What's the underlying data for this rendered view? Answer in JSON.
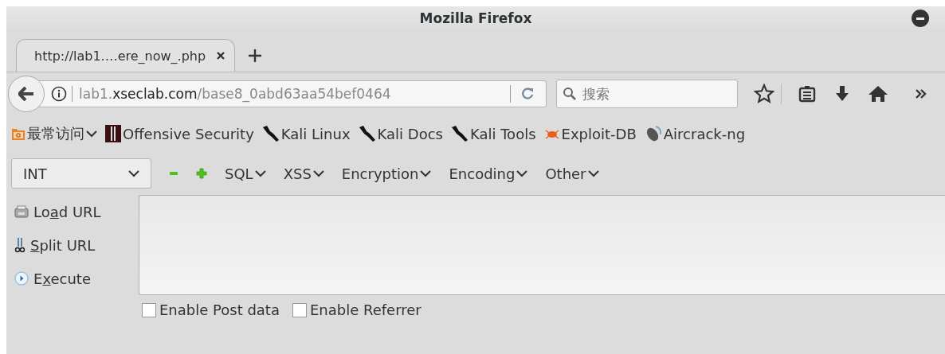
{
  "window": {
    "title": "Mozilla Firefox"
  },
  "tabs": [
    {
      "label": "http://lab1.…ere_now_.php",
      "selected": true
    }
  ],
  "address": {
    "prefix": "lab1.",
    "domain": "xseclab.com",
    "path": "/base8_0abd63aa54bef0464"
  },
  "search": {
    "placeholder": "搜索"
  },
  "bookmarks": [
    {
      "label": "最常访问",
      "kind": "folder"
    },
    {
      "label": "Offensive Security",
      "kind": "offsec"
    },
    {
      "label": "Kali Linux",
      "kind": "kali"
    },
    {
      "label": "Kali Docs",
      "kind": "kali"
    },
    {
      "label": "Kali Tools",
      "kind": "kali"
    },
    {
      "label": "Exploit-DB",
      "kind": "bug"
    },
    {
      "label": "Aircrack-ng",
      "kind": "dish"
    }
  ],
  "hackbar": {
    "select": "INT",
    "menus": [
      "SQL",
      "XSS",
      "Encryption",
      "Encoding",
      "Other"
    ],
    "actions": [
      {
        "before": "Lo",
        "key": "a",
        "after": "d URL",
        "kind": "load"
      },
      {
        "key": "S",
        "after": "plit URL",
        "kind": "split"
      },
      {
        "before": "E",
        "key": "x",
        "after": "ecute",
        "kind": "execute"
      }
    ],
    "options": [
      {
        "label": "Enable Post data",
        "checked": false
      },
      {
        "label": "Enable Referrer",
        "checked": false
      }
    ]
  }
}
